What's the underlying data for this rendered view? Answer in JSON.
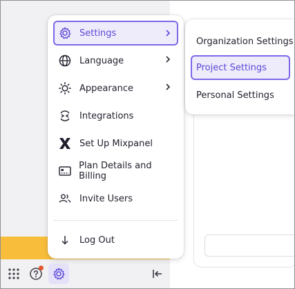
{
  "menu": {
    "items": [
      {
        "label": "Settings",
        "icon": "gear-icon",
        "has_submenu": true,
        "active": true
      },
      {
        "label": "Language",
        "icon": "globe-icon",
        "has_submenu": true
      },
      {
        "label": "Appearance",
        "icon": "sun-icon",
        "has_submenu": true
      },
      {
        "label": "Integrations",
        "icon": "integrations-icon",
        "has_submenu": false
      },
      {
        "label": "Set Up Mixpanel",
        "icon": "mixpanel-logo-icon",
        "has_submenu": false
      },
      {
        "label": "Plan Details and Billing",
        "icon": "billing-card-icon",
        "has_submenu": false
      },
      {
        "label": "Invite Users",
        "icon": "users-icon",
        "has_submenu": false
      }
    ],
    "logout": {
      "label": "Log Out",
      "icon": "arrow-down-icon"
    }
  },
  "submenu": {
    "items": [
      {
        "label": "Organization Settings"
      },
      {
        "label": "Project Settings",
        "active": true
      },
      {
        "label": "Personal Settings"
      }
    ]
  },
  "bottom_bar": {
    "apps_icon": "grid-icon",
    "help_icon": "help-icon",
    "settings_icon": "gear-icon",
    "collapse_icon": "collapse-sidebar-icon",
    "has_notification": true
  },
  "colors": {
    "accent": "#7a68e8",
    "accent_bg": "#eeebfb",
    "banner": "#f8bd3a",
    "notification": "#e4572e"
  }
}
